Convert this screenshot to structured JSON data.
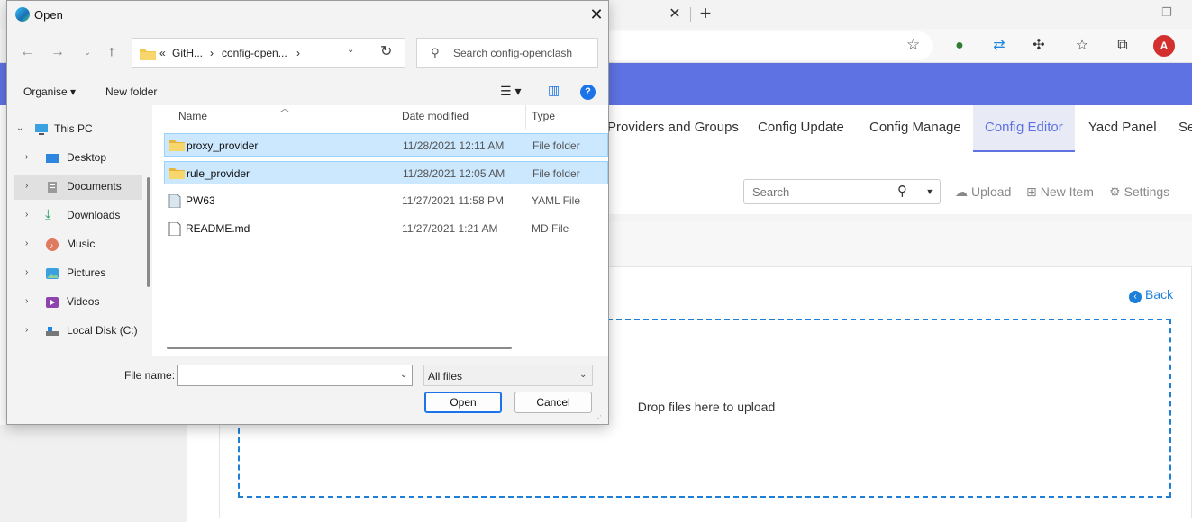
{
  "browser": {
    "close_tab_glyph": "✕",
    "new_tab_glyph": "+",
    "minimize_glyph": "—",
    "restore_glyph": "❐",
    "avatar_text": "A",
    "accent_color": "#5e72e4"
  },
  "page": {
    "nav_tabs": [
      "Providers and Groups",
      "Config Update",
      "Config Manage",
      "Config Editor",
      "Yacd Panel",
      "Se"
    ],
    "active_tab": "Config Editor",
    "search_placeholder": "Search",
    "actions": {
      "upload": "Upload",
      "new_item": "New Item",
      "settings": "Settings"
    },
    "back_label": "Back",
    "dropzone_text": "Drop files here to upload"
  },
  "dialog": {
    "title": "Open",
    "breadcrumb": [
      "«",
      "GitH...",
      "›",
      "config-open...",
      "›"
    ],
    "search_placeholder": "Search config-openclash",
    "commands": {
      "organise": "Organise ▾",
      "new_folder": "New folder",
      "help": "?"
    },
    "tree": [
      {
        "label": "This PC",
        "icon": "pc-icon",
        "expanded": true
      },
      {
        "label": "Desktop",
        "icon": "desktop-icon"
      },
      {
        "label": "Documents",
        "icon": "documents-icon",
        "selected": true
      },
      {
        "label": "Downloads",
        "icon": "downloads-icon"
      },
      {
        "label": "Music",
        "icon": "music-icon"
      },
      {
        "label": "Pictures",
        "icon": "pictures-icon"
      },
      {
        "label": "Videos",
        "icon": "videos-icon"
      },
      {
        "label": "Local Disk (C:)",
        "icon": "drive-icon"
      }
    ],
    "columns": {
      "name": "Name",
      "date": "Date modified",
      "type": "Type"
    },
    "files": [
      {
        "name": "proxy_provider",
        "date": "11/28/2021 12:11 AM",
        "type": "File folder",
        "icon": "folder-icon",
        "selected": true
      },
      {
        "name": "rule_provider",
        "date": "11/28/2021 12:05 AM",
        "type": "File folder",
        "icon": "folder-icon",
        "selected": true
      },
      {
        "name": "PW63",
        "date": "11/27/2021 11:58 PM",
        "type": "YAML File",
        "icon": "yaml-file-icon"
      },
      {
        "name": "README.md",
        "date": "11/27/2021 1:21 AM",
        "type": "MD File",
        "icon": "md-file-icon"
      }
    ],
    "file_name_label": "File name:",
    "file_name_value": "",
    "filter_value": "All files",
    "open_button": "Open",
    "cancel_button": "Cancel"
  }
}
